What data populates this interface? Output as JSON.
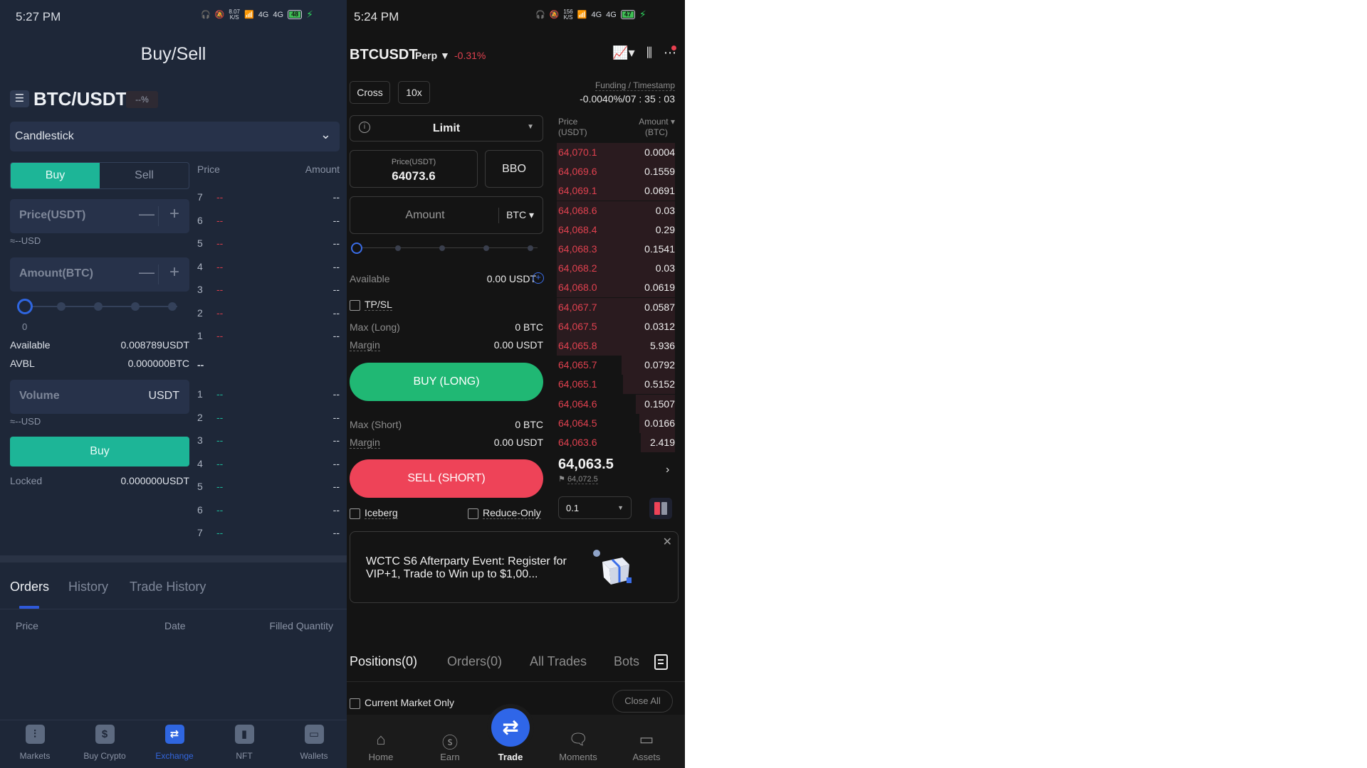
{
  "left": {
    "status": {
      "time": "5:27 PM",
      "speed": "8.07",
      "speed_unit": "K/S",
      "network1": "4G",
      "network2": "4G",
      "battery": "48"
    },
    "title": "Buy/Sell",
    "pair": {
      "name": "BTC/USDT",
      "change": "--%"
    },
    "chart_type": "Candlestick",
    "side_tabs": {
      "buy": "Buy",
      "sell": "Sell",
      "active": "Buy"
    },
    "price_field": {
      "placeholder": "Price(USDT)",
      "approx": "≈--USD"
    },
    "amount_field": {
      "placeholder": "Amount(BTC)"
    },
    "slider": {
      "value_label": "0",
      "percent": 0
    },
    "available": {
      "label": "Available",
      "value": "0.008789USDT"
    },
    "avbl": {
      "label": "AVBL",
      "value": "0.000000BTC"
    },
    "volume_field": {
      "placeholder": "Volume",
      "unit": "USDT",
      "approx": "≈--USD"
    },
    "buy_button": "Buy",
    "locked": {
      "label": "Locked",
      "value": "0.000000USDT"
    },
    "orderbook": {
      "price_header": "Price",
      "amount_header": "Amount",
      "asks": [
        {
          "idx": "7",
          "price": "--",
          "amount": "--"
        },
        {
          "idx": "6",
          "price": "--",
          "amount": "--"
        },
        {
          "idx": "5",
          "price": "--",
          "amount": "--"
        },
        {
          "idx": "4",
          "price": "--",
          "amount": "--"
        },
        {
          "idx": "3",
          "price": "--",
          "amount": "--"
        },
        {
          "idx": "2",
          "price": "--",
          "amount": "--"
        },
        {
          "idx": "1",
          "price": "--",
          "amount": "--"
        }
      ],
      "mid": "--",
      "bids": [
        {
          "idx": "1",
          "price": "--",
          "amount": "--"
        },
        {
          "idx": "2",
          "price": "--",
          "amount": "--"
        },
        {
          "idx": "3",
          "price": "--",
          "amount": "--"
        },
        {
          "idx": "4",
          "price": "--",
          "amount": "--"
        },
        {
          "idx": "5",
          "price": "--",
          "amount": "--"
        },
        {
          "idx": "6",
          "price": "--",
          "amount": "--"
        },
        {
          "idx": "7",
          "price": "--",
          "amount": "--"
        }
      ]
    },
    "tabs": [
      {
        "label": "Orders",
        "active": true
      },
      {
        "label": "History"
      },
      {
        "label": "Trade History"
      }
    ],
    "orders_columns": [
      "Price",
      "Date",
      "Filled Quantity"
    ],
    "nav": [
      {
        "label": "Markets",
        "icon": "candlestick-icon"
      },
      {
        "label": "Buy Crypto",
        "icon": "dollar-icon"
      },
      {
        "label": "Exchange",
        "icon": "exchange-icon",
        "active": true
      },
      {
        "label": "NFT",
        "icon": "bookmark-icon"
      },
      {
        "label": "Wallets",
        "icon": "wallet-icon"
      }
    ]
  },
  "right": {
    "status": {
      "time": "5:24 PM",
      "speed": "156",
      "speed_unit": "K/S",
      "network1": "4G",
      "network2": "4G",
      "battery": "47"
    },
    "symbol": "BTCUSDT",
    "contract": "Perp ▼",
    "change": "-0.31%",
    "margin_mode": "Cross",
    "leverage": "10x",
    "funding_label": "Funding / Timestamp",
    "funding_value": "-0.0040%/07 : 35 : 03",
    "order_type": "Limit",
    "price_caption": "Price(USDT)",
    "price_value": "64073.6",
    "bbo": "BBO",
    "amount_placeholder": "Amount",
    "amount_unit": "BTC ▾",
    "slider_percent": 0,
    "available": {
      "label": "Available",
      "value": "0.00 USDT"
    },
    "tpsl": "TP/SL",
    "max_long": {
      "label": "Max (Long)",
      "value": "0 BTC"
    },
    "margin_long": {
      "label": "Margin",
      "value": "0.00 USDT"
    },
    "buy_long": "BUY (LONG)",
    "max_short": {
      "label": "Max (Short)",
      "value": "0 BTC"
    },
    "margin_short": {
      "label": "Margin",
      "value": "0.00 USDT"
    },
    "sell_short": "SELL (SHORT)",
    "iceberg": "Iceberg",
    "reduce_only": "Reduce-Only",
    "orderbook": {
      "price_header_1": "Price",
      "price_header_2": "(USDT)",
      "amount_header_1": "Amount ▾",
      "amount_header_2": "(BTC)",
      "asks": [
        {
          "price": "64,070.1",
          "amount": "0.0004",
          "depth": 1.0
        },
        {
          "price": "64,069.6",
          "amount": "0.1559",
          "depth": 1.0
        },
        {
          "price": "64,069.1",
          "amount": "0.0691",
          "depth": 1.0
        },
        {
          "price": "64,068.6",
          "amount": "0.03",
          "depth": 1.0
        },
        {
          "price": "64,068.4",
          "amount": "0.29",
          "depth": 1.0
        },
        {
          "price": "64,068.3",
          "amount": "0.1541",
          "depth": 1.0
        },
        {
          "price": "64,068.2",
          "amount": "0.03",
          "depth": 1.0
        },
        {
          "price": "64,068.0",
          "amount": "0.0619",
          "depth": 1.0
        },
        {
          "price": "64,067.7",
          "amount": "0.0587",
          "depth": 1.0
        },
        {
          "price": "64,067.5",
          "amount": "0.0312",
          "depth": 1.0
        },
        {
          "price": "64,065.8",
          "amount": "5.936",
          "depth": 1.0
        },
        {
          "price": "64,065.7",
          "amount": "0.0792",
          "depth": 0.45
        },
        {
          "price": "64,065.1",
          "amount": "0.5152",
          "depth": 0.44
        },
        {
          "price": "64,064.6",
          "amount": "0.1507",
          "depth": 0.33
        },
        {
          "price": "64,064.5",
          "amount": "0.0166",
          "depth": 0.3
        },
        {
          "price": "64,063.6",
          "amount": "2.419",
          "depth": 0.29
        }
      ],
      "last_price": "64,063.5",
      "mark_price": "64,072.5",
      "depth_step": "0.1"
    },
    "banner": {
      "text": "WCTC S6 Afterparty Event: Register for VIP+1, Trade to Win up to $1,00..."
    },
    "tabs": [
      {
        "label": "Positions(0)",
        "active": true
      },
      {
        "label": "Orders(0)"
      },
      {
        "label": "All Trades"
      },
      {
        "label": "Bots"
      }
    ],
    "current_market_only": "Current Market Only",
    "close_all": "Close All",
    "nav": [
      {
        "label": "Home",
        "icon": "home-icon"
      },
      {
        "label": "Earn",
        "icon": "earn-icon"
      },
      {
        "label": "Trade",
        "icon": "trade-icon",
        "active": true
      },
      {
        "label": "Moments",
        "icon": "chat-icon"
      },
      {
        "label": "Assets",
        "icon": "wallet-icon"
      }
    ]
  }
}
